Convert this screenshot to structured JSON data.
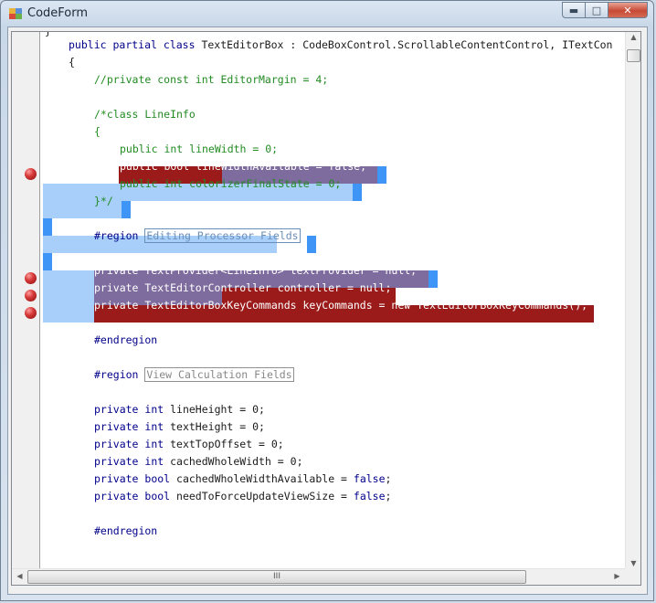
{
  "window": {
    "title": "CodeForm",
    "icon": "form-app-icon",
    "caption_buttons": {
      "minimize": "minimize-icon",
      "maximize": "maximize-icon",
      "close": "close-icon"
    }
  },
  "editor": {
    "line_height": 19,
    "breakpoint_color": "#cc2222",
    "breakpoint_highlight_color": "#9b1b1b",
    "selection_color": "#a8cff9",
    "selection_edge_color": "#3e95f5",
    "keyword_color": "#00008b",
    "comment_color": "#228b22"
  },
  "scrollbars": {
    "horizontal_thumb_grip": "III"
  }
}
